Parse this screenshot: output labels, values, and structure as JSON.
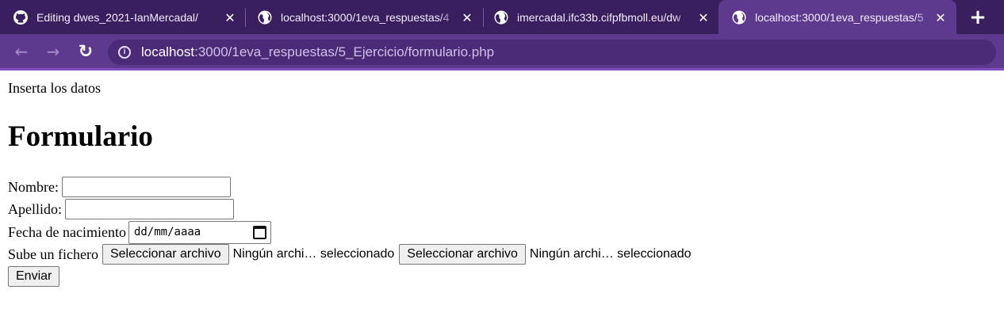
{
  "browser": {
    "tabs": [
      {
        "title": "Editing dwes_2021-IanMercadal/",
        "icon": "github-icon",
        "active": false
      },
      {
        "title": "localhost:3000/1eva_respuestas/4",
        "icon": "globe-icon",
        "active": false
      },
      {
        "title": "imercadal.ifc33b.cifpfbmoll.eu/dw",
        "icon": "globe-icon",
        "active": false
      },
      {
        "title": "localhost:3000/1eva_respuestas/5",
        "icon": "globe-icon",
        "active": true
      }
    ],
    "close_glyph": "✕",
    "new_tab_glyph": "+",
    "nav": {
      "back": "←",
      "forward": "→",
      "reload": "↻"
    },
    "url_host": "localhost",
    "url_path": ":3000/1eva_respuestas/5_Ejercicio/formulario.php",
    "colors": {
      "tabstrip": "#3a1f5e",
      "toolbar": "#5e3a8f",
      "omnibox": "#4b2a78"
    }
  },
  "page": {
    "intro": "Inserta los datos",
    "heading": "Formulario",
    "form": {
      "nombre_label": "Nombre:",
      "nombre_value": "",
      "apellido_label": "Apellido:",
      "apellido_value": "",
      "fecha_label": "Fecha de nacimiento",
      "fecha_placeholder": "dd/mm/aaaa",
      "fichero_label": "Sube un fichero",
      "file_inputs": [
        {
          "button": "Seleccionar archivo",
          "status": "Ningún archi… seleccionado"
        },
        {
          "button": "Seleccionar archivo",
          "status": "Ningún archi… seleccionado"
        }
      ],
      "submit": "Enviar"
    }
  }
}
